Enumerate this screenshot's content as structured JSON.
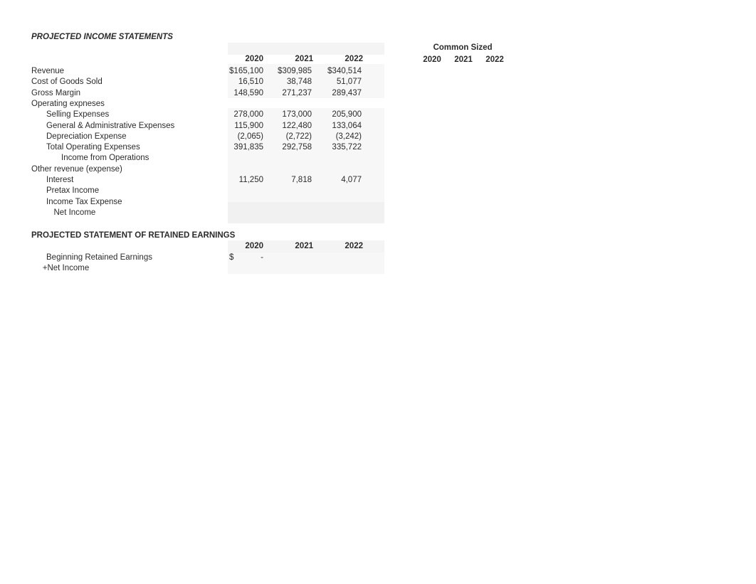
{
  "document": {
    "income_statement_title": "PROJECTED INCOME STATEMENTS",
    "retained_earnings_title": "PROJECTED STATEMENT OF RETAINED EARNINGS",
    "common_sized_title": "Common Sized"
  },
  "columns": {
    "years": [
      "2020",
      "2021",
      "2022"
    ],
    "currency_symbol": "$",
    "dash": "-"
  },
  "common_sized": {
    "header": "Common Sized",
    "years": [
      "2020",
      "2021",
      "2022"
    ],
    "values": [
      {
        "y2020": "",
        "y2021": "",
        "y2022": ""
      }
    ]
  },
  "income_statement": {
    "rows": [
      {
        "label": "Revenue",
        "indent": 0,
        "y2020": "165,100",
        "y2021": "309,985",
        "y2022": "340,514",
        "currency": true
      },
      {
        "label": "Cost of Goods Sold",
        "indent": 0,
        "y2020": "16,510",
        "y2021": "38,748",
        "y2022": "51,077",
        "currency": false
      },
      {
        "label": "Gross Margin",
        "indent": 0,
        "y2020": "148,590",
        "y2021": "271,237",
        "y2022": "289,437",
        "currency": false
      },
      {
        "label": "Operating expneses",
        "indent": 0,
        "y2020": "",
        "y2021": "",
        "y2022": "",
        "currency": false
      },
      {
        "label": "Selling Expenses",
        "indent": 1,
        "y2020": "278,000",
        "y2021": "173,000",
        "y2022": "205,900",
        "currency": false
      },
      {
        "label": "General & Administrative Expenses",
        "indent": 1,
        "y2020": "115,900",
        "y2021": "122,480",
        "y2022": "133,064",
        "currency": false
      },
      {
        "label": "Depreciation Expense",
        "indent": 1,
        "y2020": "(2,065)",
        "y2021": "(2,722)",
        "y2022": "(3,242)",
        "currency": false
      },
      {
        "label": "Total Operating Expenses",
        "indent": 1,
        "y2020": "391,835",
        "y2021": "292,758",
        "y2022": "335,722",
        "currency": false
      },
      {
        "label": "Income from Operations",
        "indent": 2,
        "y2020": "",
        "y2021": "",
        "y2022": "",
        "currency": false
      },
      {
        "label": "Other revenue (expense)",
        "indent": 0,
        "y2020": "",
        "y2021": "",
        "y2022": "",
        "currency": false
      },
      {
        "label": "Interest",
        "indent": 1,
        "y2020": "11,250",
        "y2021": "7,818",
        "y2022": "4,077",
        "currency": false
      },
      {
        "label": "Pretax Income",
        "indent": 1,
        "y2020": "",
        "y2021": "",
        "y2022": "",
        "currency": false
      },
      {
        "label": "Income Tax Expense",
        "indent": 1,
        "y2020": "",
        "y2021": "",
        "y2022": "",
        "currency": false
      },
      {
        "label": "Net Income",
        "indent": 1.5,
        "y2020": "",
        "y2021": "",
        "y2022": "",
        "currency": false
      }
    ]
  },
  "retained_earnings": {
    "rows": [
      {
        "label": "Beginning Retained Earnings",
        "indent": 1,
        "y2020": "-",
        "y2021": "",
        "y2022": "",
        "currency": true
      },
      {
        "label": "+Net Income",
        "indent": 0.75,
        "y2020": "",
        "y2021": "",
        "y2022": "",
        "currency": false
      }
    ]
  }
}
